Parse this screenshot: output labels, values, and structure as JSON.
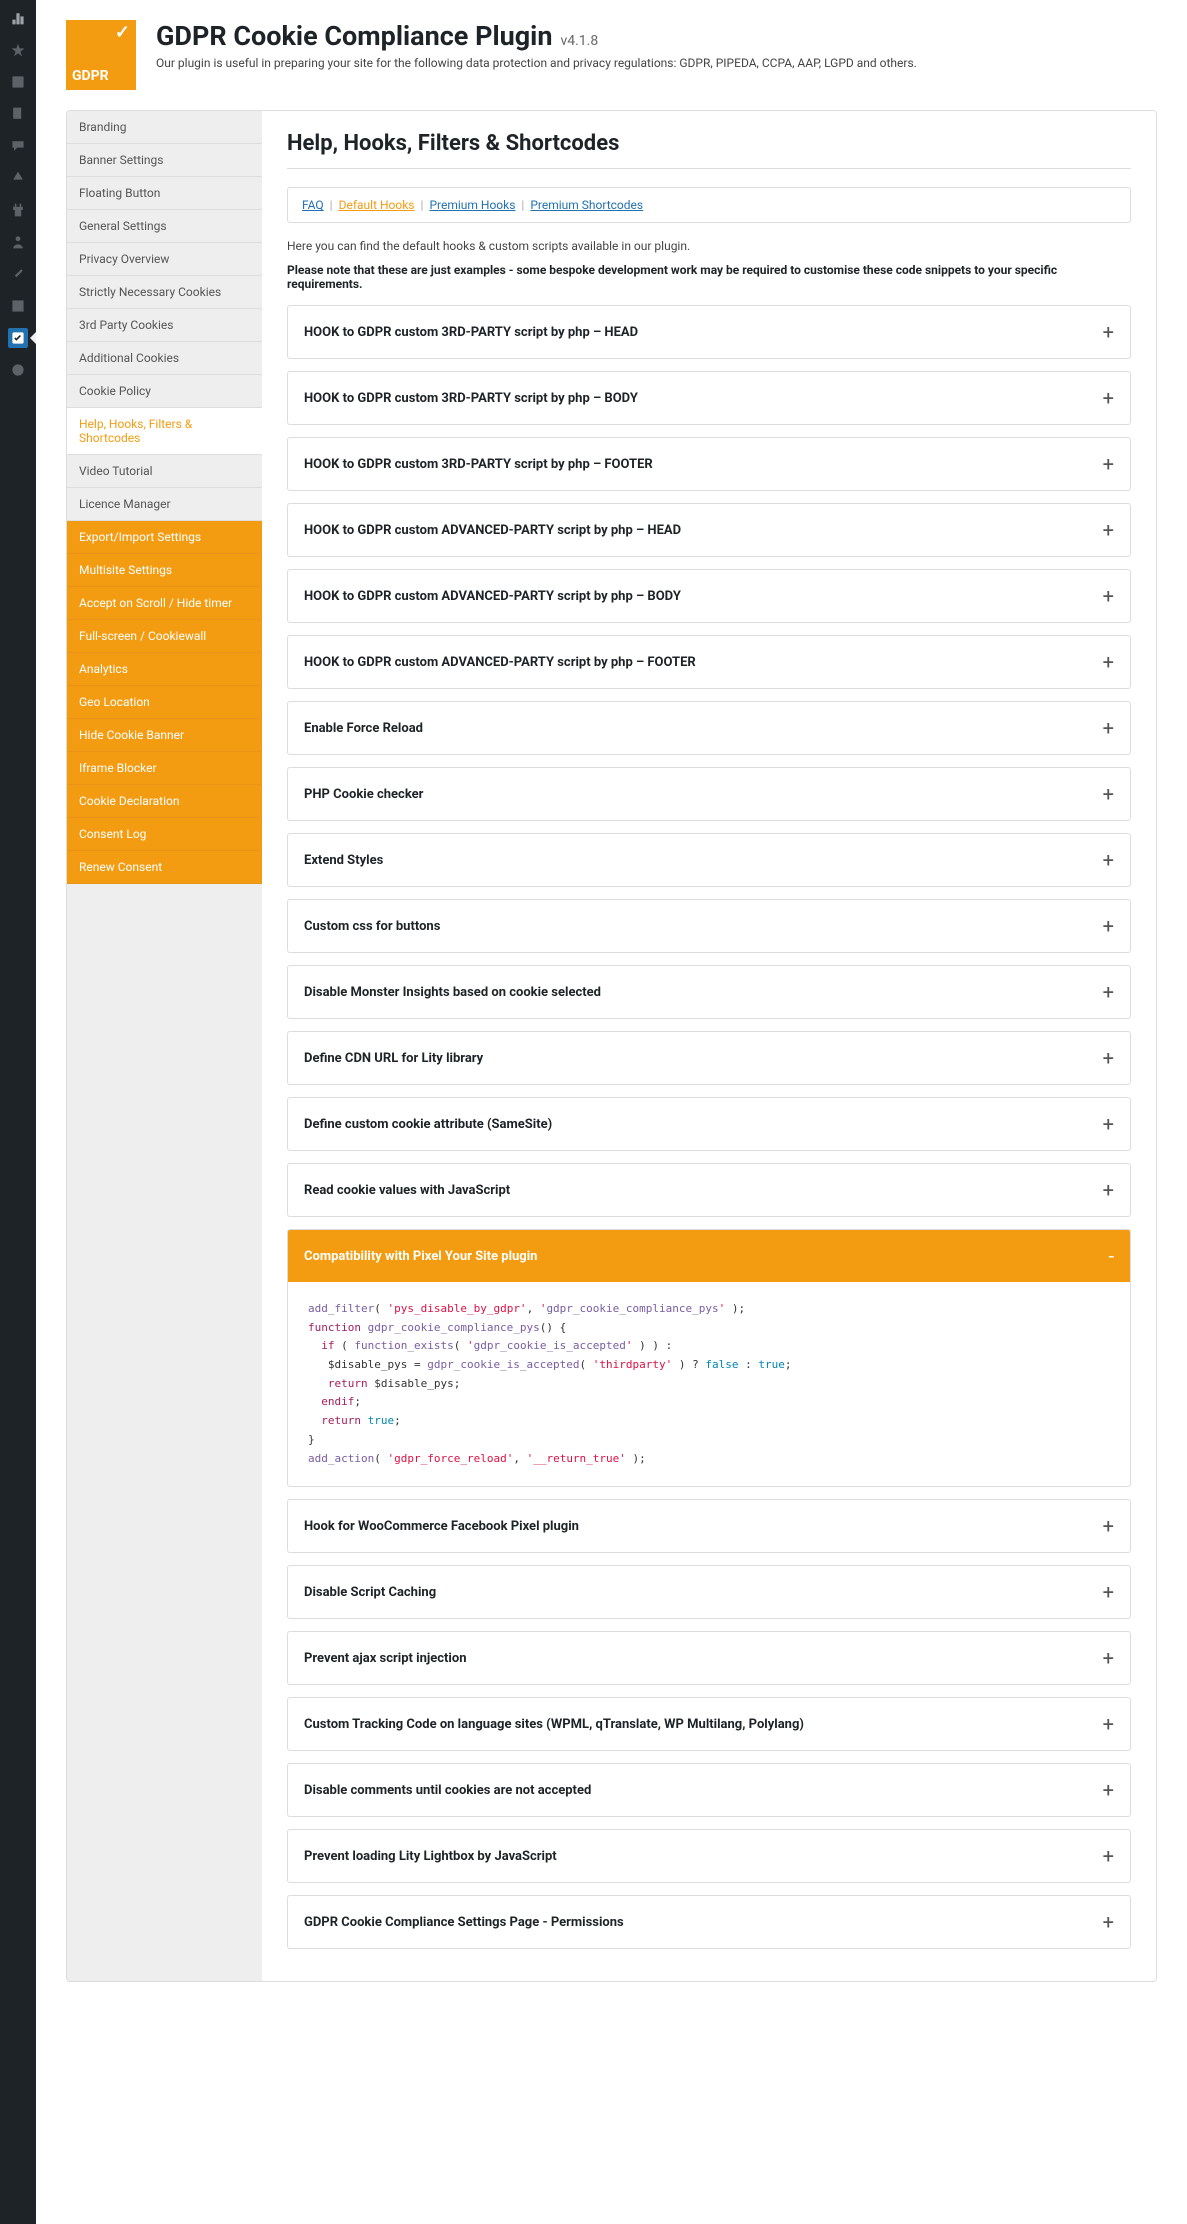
{
  "header": {
    "logo_text": "GDPR",
    "title": "GDPR Cookie Compliance Plugin",
    "version": "v4.1.8",
    "subtitle": "Our plugin is useful in preparing your site for the following data protection and privacy regulations: GDPR, PIPEDA, CCPA, AAP, LGPD and others."
  },
  "sidebar": {
    "items": [
      {
        "label": "Branding",
        "type": "std"
      },
      {
        "label": "Banner Settings",
        "type": "std"
      },
      {
        "label": "Floating Button",
        "type": "std"
      },
      {
        "label": "General Settings",
        "type": "std"
      },
      {
        "label": "Privacy Overview",
        "type": "std"
      },
      {
        "label": "Strictly Necessary Cookies",
        "type": "std"
      },
      {
        "label": "3rd Party Cookies",
        "type": "std"
      },
      {
        "label": "Additional Cookies",
        "type": "std"
      },
      {
        "label": "Cookie Policy",
        "type": "std"
      },
      {
        "label": "Help, Hooks, Filters & Shortcodes",
        "type": "active"
      },
      {
        "label": "Video Tutorial",
        "type": "std"
      },
      {
        "label": "Licence Manager",
        "type": "std"
      },
      {
        "label": "Export/Import Settings",
        "type": "premium"
      },
      {
        "label": "Multisite Settings",
        "type": "premium"
      },
      {
        "label": "Accept on Scroll / Hide timer",
        "type": "premium"
      },
      {
        "label": "Full-screen / Cookiewall",
        "type": "premium"
      },
      {
        "label": "Analytics",
        "type": "premium"
      },
      {
        "label": "Geo Location",
        "type": "premium"
      },
      {
        "label": "Hide Cookie Banner",
        "type": "premium"
      },
      {
        "label": "Iframe Blocker",
        "type": "premium"
      },
      {
        "label": "Cookie Declaration",
        "type": "premium"
      },
      {
        "label": "Consent Log",
        "type": "premium"
      },
      {
        "label": "Renew Consent",
        "type": "premium"
      }
    ]
  },
  "panel": {
    "title": "Help, Hooks, Filters & Shortcodes",
    "tabs": [
      {
        "label": "FAQ",
        "current": false
      },
      {
        "label": "Default Hooks",
        "current": true
      },
      {
        "label": "Premium Hooks",
        "current": false
      },
      {
        "label": "Premium Shortcodes",
        "current": false
      }
    ],
    "intro": "Here you can find the default hooks & custom scripts available in our plugin.",
    "note": "Please note that these are just examples - some bespoke development work may be required to customise these code snippets to your specific requirements.",
    "accordions": [
      {
        "title": "HOOK to GDPR custom 3RD-PARTY script by php – HEAD",
        "open": false
      },
      {
        "title": "HOOK to GDPR custom 3RD-PARTY script by php – BODY",
        "open": false
      },
      {
        "title": "HOOK to GDPR custom 3RD-PARTY script by php – FOOTER",
        "open": false
      },
      {
        "title": "HOOK to GDPR custom ADVANCED-PARTY script by php – HEAD",
        "open": false
      },
      {
        "title": "HOOK to GDPR custom ADVANCED-PARTY script by php – BODY",
        "open": false
      },
      {
        "title": "HOOK to GDPR custom ADVANCED-PARTY script by php – FOOTER",
        "open": false
      },
      {
        "title": "Enable Force Reload",
        "open": false
      },
      {
        "title": "PHP Cookie checker",
        "open": false
      },
      {
        "title": "Extend Styles",
        "open": false
      },
      {
        "title": "Custom css for buttons",
        "open": false
      },
      {
        "title": "Disable Monster Insights based on cookie selected",
        "open": false
      },
      {
        "title": "Define CDN URL for Lity library",
        "open": false
      },
      {
        "title": "Define custom cookie attribute (SameSite)",
        "open": false
      },
      {
        "title": "Read cookie values with JavaScript",
        "open": false
      },
      {
        "title": "Compatibility with Pixel Your Site plugin",
        "open": true,
        "code": "add_filter( 'pys_disable_by_gdpr', 'gdpr_cookie_compliance_pys' );\nfunction gdpr_cookie_compliance_pys() {\n  if ( function_exists( 'gdpr_cookie_is_accepted' ) ) :\n   $disable_pys = gdpr_cookie_is_accepted( 'thirdparty' ) ? false : true;\n   return $disable_pys;\n  endif;\n  return true;\n}\nadd_action( 'gdpr_force_reload', '__return_true' );"
      },
      {
        "title": "Hook for WooCommerce Facebook Pixel plugin",
        "open": false
      },
      {
        "title": "Disable Script Caching",
        "open": false
      },
      {
        "title": "Prevent ajax script injection",
        "open": false
      },
      {
        "title": "Custom Tracking Code on language sites (WPML, qTranslate, WP Multilang, Polylang)",
        "open": false
      },
      {
        "title": "Disable comments until cookies are not accepted",
        "open": false
      },
      {
        "title": "Prevent loading Lity Lightbox by JavaScript",
        "open": false
      },
      {
        "title": "GDPR Cookie Compliance Settings Page - Permissions",
        "open": false
      }
    ]
  }
}
